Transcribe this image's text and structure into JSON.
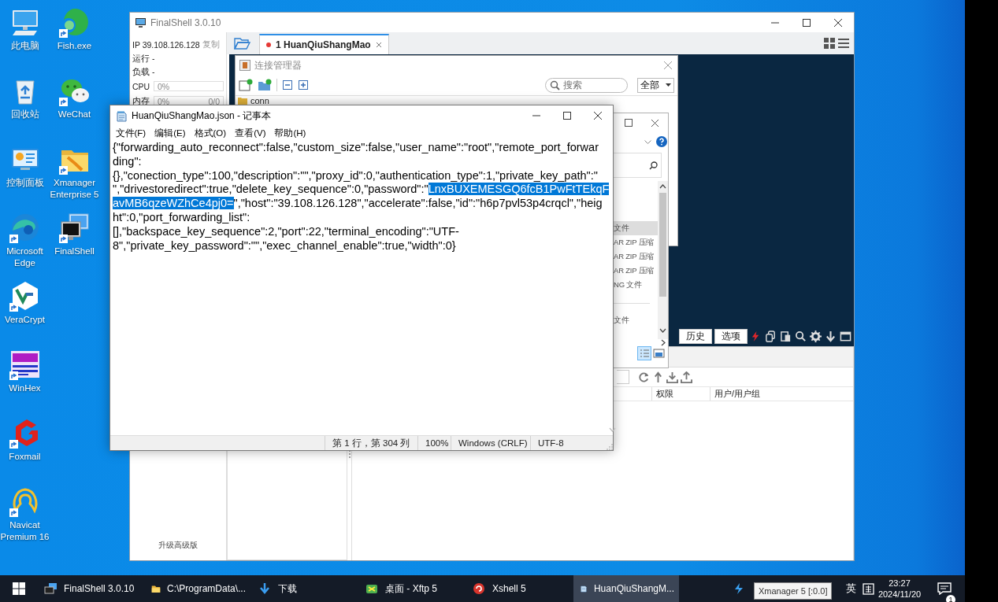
{
  "desktop": {
    "icons": [
      {
        "label": "此电脑",
        "kind": "computer",
        "shortcut": false
      },
      {
        "label": "回收站",
        "kind": "recycle",
        "shortcut": false
      },
      {
        "label": "控制面板",
        "kind": "control",
        "shortcut": false
      },
      {
        "label": "Microsoft Edge",
        "kind": "edge",
        "shortcut": true
      },
      {
        "label": "VeraCrypt",
        "kind": "veracrypt",
        "shortcut": true
      },
      {
        "label": "WinHex",
        "kind": "winhex",
        "shortcut": true
      },
      {
        "label": "Foxmail",
        "kind": "foxmail",
        "shortcut": true
      },
      {
        "label": "Navicat Premium 16",
        "kind": "navicat",
        "shortcut": true
      },
      {
        "label": "Fish.exe",
        "kind": "fish",
        "shortcut": true
      },
      {
        "label": "WeChat",
        "kind": "wechat",
        "shortcut": true
      },
      {
        "label": "Xmanager Enterprise 5",
        "kind": "xmanager",
        "shortcut": true
      },
      {
        "label": "FinalShell",
        "kind": "finalshell",
        "shortcut": true
      }
    ]
  },
  "finalshell": {
    "title": "FinalShell 3.0.10",
    "sidebar": {
      "ip": "IP 39.108.126.128",
      "copy": "复制",
      "stats": [
        "运行 -",
        "负载 -"
      ],
      "meters": [
        {
          "label": "CPU",
          "value": "0%",
          "level": 0
        },
        {
          "label": "内存",
          "value": "0%",
          "extra": "0/0",
          "level": 0
        }
      ],
      "upgrade": "升级高级版"
    },
    "tabs": [
      {
        "label": "1 HuanQiuShangMao",
        "selected": true,
        "connected": false
      }
    ],
    "connection_manager": {
      "title": "连接管理器",
      "search": {
        "placeholder": "搜索"
      },
      "filter": "全部",
      "tree": [
        {
          "label": "conn",
          "kind": "folder"
        }
      ]
    },
    "file_dialog": {
      "groups": [
        {
          "items": [
            {
              "label": "文件",
              "selected": true
            },
            {
              "label": "AR ZIP 压缩",
              "selected": false
            },
            {
              "label": "AR ZIP 压缩",
              "selected": false
            },
            {
              "label": "AR ZIP 压缩",
              "selected": false
            },
            {
              "label": "NG 文件",
              "selected": false
            }
          ]
        },
        {
          "items": [
            {
              "label": "文件",
              "selected": false
            }
          ]
        }
      ]
    },
    "terminal_toolbar": {
      "buttons": [
        "历史",
        "选项"
      ]
    },
    "file_panel": {
      "columns": [
        "权限",
        "用户/用户组"
      ]
    }
  },
  "notepad": {
    "title": "HuanQiuShangMao.json - 记事本",
    "menu": [
      "文件(F)",
      "编辑(E)",
      "格式(O)",
      "查看(V)",
      "帮助(H)"
    ],
    "lines": [
      {
        "segments": [
          {
            "text": "{\"forwarding_auto_reconnect\":false,\"custom_size\":false,\"user_name\":\"root\",\"remote_port_forwar",
            "selected": false
          }
        ]
      },
      {
        "segments": [
          {
            "text": "ding\":",
            "selected": false
          }
        ]
      },
      {
        "segments": [
          {
            "text": "{},\"conection_type\":100,\"description\":\"\",\"proxy_id\":0,\"authentication_type\":1,\"private_key_path\":\"",
            "selected": false
          }
        ]
      },
      {
        "segments": [
          {
            "text": "\",\"drivestoredirect\":true,\"delete_key_sequence\":0,\"password\":\"",
            "selected": false
          },
          {
            "text": "LnxBUXEMESGQ6fcB1PwFtTEkqF",
            "selected": true
          }
        ]
      },
      {
        "segments": [
          {
            "text": "avMB6qzeWZhCe4pj0=",
            "selected": true
          },
          {
            "text": "\",\"host\":\"39.108.126.128\",\"accelerate\":false,\"id\":\"h6p7pvl53p4crqcl\",\"heig",
            "selected": false
          }
        ]
      },
      {
        "segments": [
          {
            "text": "ht\":0,\"port_forwarding_list\":",
            "selected": false
          }
        ]
      },
      {
        "segments": [
          {
            "text": "[],\"backspace_key_sequence\":2,\"port\":22,\"terminal_encoding\":\"UTF-",
            "selected": false
          }
        ]
      },
      {
        "segments": [
          {
            "text": "8\",\"private_key_password\":\"\",\"exec_channel_enable\":true,\"width\":0}",
            "selected": false
          }
        ]
      }
    ],
    "status": [
      "第 1 行，第 304 列",
      "100%",
      "Windows (CRLF)",
      "UTF-8"
    ]
  },
  "taskbar": {
    "items": [
      {
        "label": "FinalShell 3.0.10",
        "kind": "finalshell",
        "active": false
      },
      {
        "label": "C:\\ProgramData\\...",
        "kind": "folder",
        "active": false
      },
      {
        "label": "下载",
        "kind": "download",
        "active": false
      },
      {
        "label": "桌面 - Xftp 5",
        "kind": "xftp",
        "active": false
      },
      {
        "label": "Xshell 5",
        "kind": "xshell",
        "active": false
      },
      {
        "label": "HuanQiuShangM...",
        "kind": "notepad",
        "active": true
      }
    ],
    "ime": "英",
    "time": "23:27",
    "date": "2024/11/20",
    "notifications": "1"
  },
  "tooltip": "Xmanager 5 [:0.0]"
}
